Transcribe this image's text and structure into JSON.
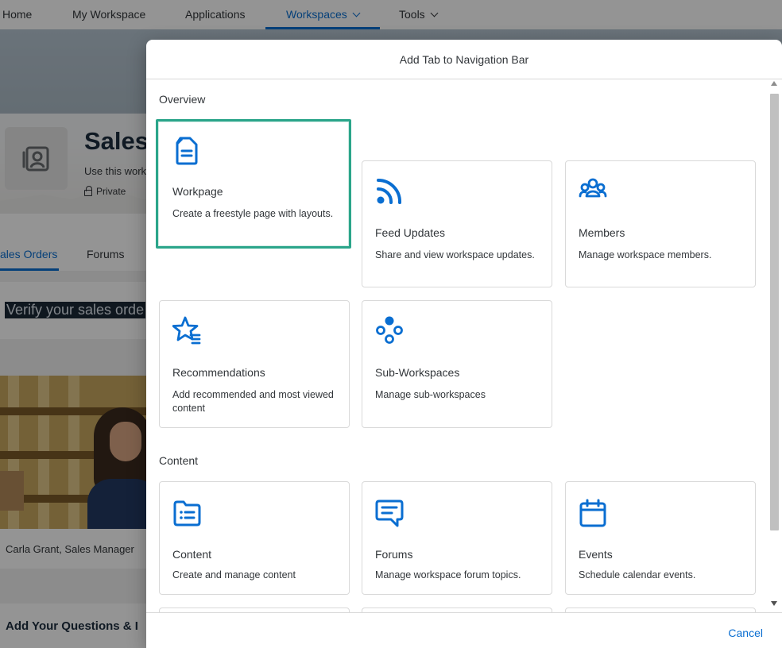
{
  "topnav": {
    "items": [
      "Home",
      "My Workspace",
      "Applications",
      "Workspaces",
      "Tools"
    ],
    "active": "Workspaces"
  },
  "workspace": {
    "title": "Sales",
    "description": "Use this work",
    "privacy": "Private"
  },
  "subtabs": [
    "ales Orders",
    "Forums"
  ],
  "notice": "Verify your sales orde",
  "photo_caption": "Carla Grant, Sales Manager",
  "questions_heading": "Add Your Questions & I",
  "dialog": {
    "title": "Add Tab to Navigation Bar",
    "sections": {
      "overview": "Overview",
      "content": "Content"
    },
    "tiles": {
      "workpage": {
        "title": "Workpage",
        "desc": "Create a freestyle page with layouts.",
        "icon": "document-icon",
        "selected": true
      },
      "feed": {
        "title": "Feed Updates",
        "desc": "Share and view workspace updates.",
        "icon": "feed-icon"
      },
      "members": {
        "title": "Members",
        "desc": "Manage workspace members.",
        "icon": "group-icon"
      },
      "recommendations": {
        "title": "Recommendations",
        "desc": "Add recommended and most viewed content",
        "icon": "star-list-icon"
      },
      "subworkspaces": {
        "title": "Sub-Workspaces",
        "desc": "Manage sub-workspaces",
        "icon": "hierarchy-icon"
      },
      "content": {
        "title": "Content",
        "desc": "Create and manage content",
        "icon": "folder-list-icon"
      },
      "forums": {
        "title": "Forums",
        "desc": "Manage workspace forum topics.",
        "icon": "discussion-icon"
      },
      "events": {
        "title": "Events",
        "desc": "Schedule calendar events.",
        "icon": "calendar-icon"
      },
      "tasks": {
        "icon": "clipboard-check-icon"
      },
      "knowledge": {
        "icon": "book-icon"
      },
      "trash": {
        "icon": "trash-icon"
      }
    },
    "cancel_label": "Cancel"
  },
  "colors": {
    "accent": "#0a6ed1",
    "selected_border": "#2ba58a",
    "icon": "#0a6ed1"
  }
}
